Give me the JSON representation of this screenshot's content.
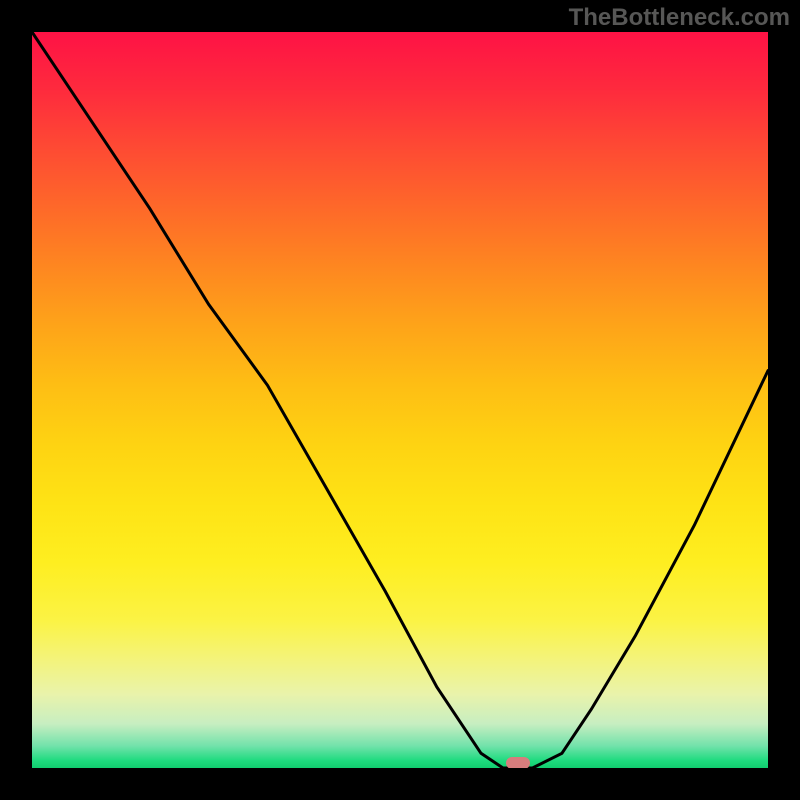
{
  "watermark": "TheBottleneck.com",
  "chart_data": {
    "type": "line",
    "title": "",
    "xlabel": "",
    "ylabel": "",
    "xlim": [
      0,
      100
    ],
    "ylim": [
      0,
      100
    ],
    "grid": false,
    "series": [
      {
        "name": "curve",
        "x": [
          0,
          8,
          16,
          24,
          32,
          40,
          48,
          55,
          61,
          64,
          68,
          72,
          76,
          82,
          90,
          100
        ],
        "y": [
          100,
          88,
          76,
          63,
          52,
          38,
          24,
          11,
          2,
          0,
          0,
          2,
          8,
          18,
          33,
          54
        ]
      }
    ],
    "marker": {
      "x": 66,
      "y": 0.7
    },
    "background_gradient": {
      "orientation": "vertical",
      "stops": [
        {
          "pos": 0,
          "color": "#fe1245"
        },
        {
          "pos": 50,
          "color": "#fed014"
        },
        {
          "pos": 80,
          "color": "#fcf24a"
        },
        {
          "pos": 100,
          "color": "#11cd6f"
        }
      ]
    }
  }
}
